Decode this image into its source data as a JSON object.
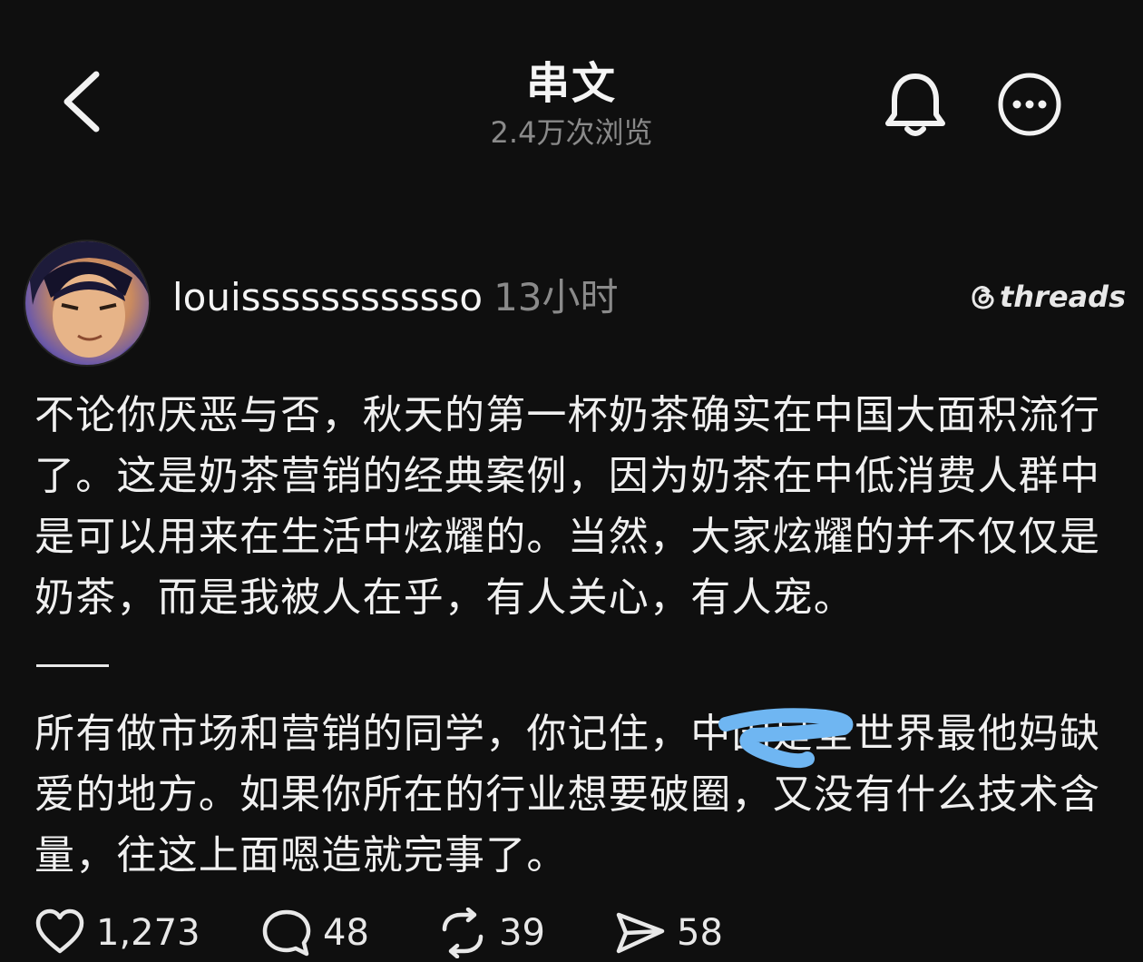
{
  "header": {
    "title": "串文",
    "views": "2.4万次浏览"
  },
  "post": {
    "username": "louissssssssssso",
    "time": "13小时",
    "brand": "threads",
    "paragraph1": "不论你厌恶与否，秋天的第一杯奶茶确实在中国大面积流行了。这是奶茶营销的经典案例，因为奶茶在中低消费人群中是可以用来在生活中炫耀的。当然，大家炫耀的并不仅仅是奶茶，而是我被人在乎，有人关心，有人宠。",
    "paragraph2": "所有做市场和营销的同学，你记住，中国是全世界最他妈缺爱的地方。如果你所在的行业想要破圈，又没有什么技术含量，往这上面嗯造就完事了。",
    "redaction_color": "#6fb6f2"
  },
  "actions": {
    "likes": "1,273",
    "comments": "48",
    "reposts": "39",
    "shares": "58"
  },
  "icons": [
    "back-arrow-icon",
    "bell-icon",
    "more-icon",
    "threads-logo-icon",
    "heart-icon",
    "comment-icon",
    "repost-icon",
    "share-icon"
  ]
}
